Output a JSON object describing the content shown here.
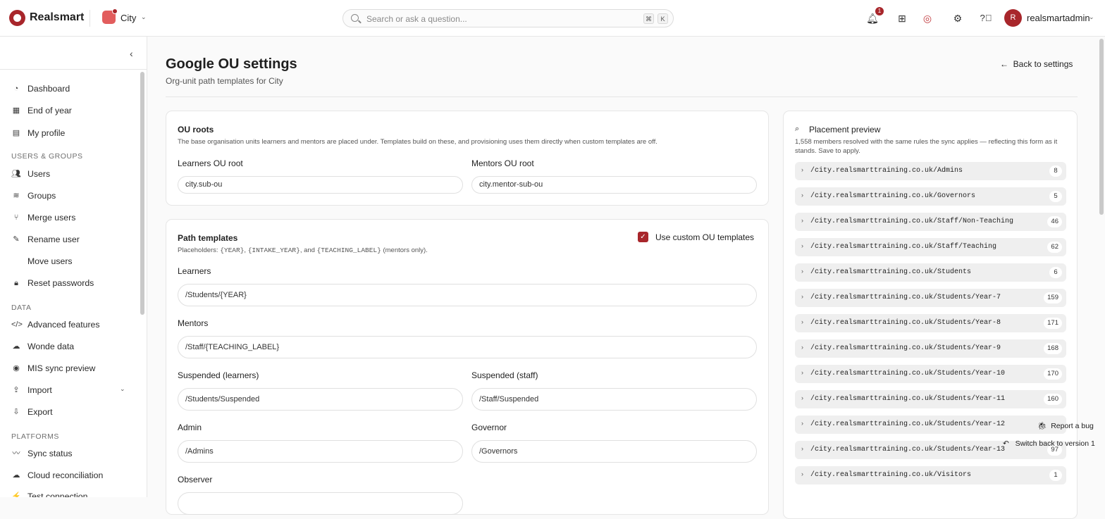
{
  "topbar": {
    "brand": "Realsmart",
    "tenant": "City",
    "search_placeholder": "Search or ask a question...",
    "kbd_cmd": "⌘",
    "kbd_k": "K",
    "notification_count": "1",
    "avatar_initial": "R",
    "username": "realsmartadmin"
  },
  "sidebar": {
    "items_top": [
      {
        "label": "Dashboard",
        "icon": "dashboard-icon"
      },
      {
        "label": "End of year",
        "icon": "calendar-icon"
      },
      {
        "label": "My profile",
        "icon": "id-card-icon"
      }
    ],
    "section_users": "USERS & GROUPS",
    "items_users": [
      {
        "label": "Users",
        "icon": "users-icon"
      },
      {
        "label": "Groups",
        "icon": "layers-icon"
      },
      {
        "label": "Merge users",
        "icon": "merge-icon"
      },
      {
        "label": "Rename user",
        "icon": "user-edit-icon"
      },
      {
        "label": "Move users",
        "icon": ""
      },
      {
        "label": "Reset passwords",
        "icon": "lock-icon"
      }
    ],
    "section_data": "DATA",
    "items_data": [
      {
        "label": "Advanced features",
        "icon": "code-icon"
      },
      {
        "label": "Wonde data",
        "icon": "cloud-icon"
      },
      {
        "label": "MIS sync preview",
        "icon": "eye-icon"
      },
      {
        "label": "Import",
        "icon": "upload-icon"
      },
      {
        "label": "Export",
        "icon": "download-icon"
      }
    ],
    "section_platforms": "PLATFORMS",
    "items_platforms": [
      {
        "label": "Sync status",
        "icon": "pulse-icon"
      },
      {
        "label": "Cloud reconciliation",
        "icon": "cloud-icon"
      },
      {
        "label": "Test connection",
        "icon": "plug-icon"
      }
    ]
  },
  "page": {
    "title": "Google OU settings",
    "subtitle": "Org-unit path templates for City",
    "back_label": "Back to settings"
  },
  "ou_roots": {
    "title": "OU roots",
    "desc": "The base organisation units learners and mentors are placed under. Templates build on these, and provisioning uses them directly when custom templates are off.",
    "learners_label": "Learners OU root",
    "learners_value": "city.sub-ou",
    "mentors_label": "Mentors OU root",
    "mentors_value": "city.mentor-sub-ou"
  },
  "templates": {
    "title": "Path templates",
    "desc_prefix": "Placeholders: ",
    "ph1": "{YEAR}",
    "sep1": ", ",
    "ph2": "{INTAKE_YEAR}",
    "sep2": ", and ",
    "ph3": "{TEACHING_LABEL}",
    "desc_suffix": " (mentors only).",
    "custom_label": "Use custom OU templates",
    "custom_checked": true,
    "learners_label": "Learners",
    "learners_value": "/Students/{YEAR}",
    "mentors_label": "Mentors",
    "mentors_value": "/Staff/{TEACHING_LABEL}",
    "susp_learners_label": "Suspended (learners)",
    "susp_learners_value": "/Students/Suspended",
    "susp_staff_label": "Suspended (staff)",
    "susp_staff_value": "/Staff/Suspended",
    "admin_label": "Admin",
    "admin_value": "/Admins",
    "governor_label": "Governor",
    "governor_value": "/Governors",
    "observer_label": "Observer"
  },
  "preview": {
    "title": "Placement preview",
    "desc": "1,558 members resolved with the same rules the sync applies — reflecting this form as it stands. Save to apply.",
    "rows": [
      {
        "path": "/city.realsmarttraining.co.uk/Admins",
        "count": "8"
      },
      {
        "path": "/city.realsmarttraining.co.uk/Governors",
        "count": "5"
      },
      {
        "path": "/city.realsmarttraining.co.uk/Staff/Non-Teaching",
        "count": "46"
      },
      {
        "path": "/city.realsmarttraining.co.uk/Staff/Teaching",
        "count": "62"
      },
      {
        "path": "/city.realsmarttraining.co.uk/Students",
        "count": "6"
      },
      {
        "path": "/city.realsmarttraining.co.uk/Students/Year-7",
        "count": "159"
      },
      {
        "path": "/city.realsmarttraining.co.uk/Students/Year-8",
        "count": "171"
      },
      {
        "path": "/city.realsmarttraining.co.uk/Students/Year-9",
        "count": "168"
      },
      {
        "path": "/city.realsmarttraining.co.uk/Students/Year-10",
        "count": "170"
      },
      {
        "path": "/city.realsmarttraining.co.uk/Students/Year-11",
        "count": "160"
      },
      {
        "path": "/city.realsmarttraining.co.uk/Students/Year-12",
        "count": ""
      },
      {
        "path": "/city.realsmarttraining.co.uk/Students/Year-13",
        "count": "97"
      },
      {
        "path": "/city.realsmarttraining.co.uk/Visitors",
        "count": "1"
      }
    ]
  },
  "floating": {
    "report_bug": "Report a bug",
    "switch_back": "Switch back to version 1"
  },
  "colors": {
    "accent": "#a8262b",
    "background": "#fafafa"
  }
}
